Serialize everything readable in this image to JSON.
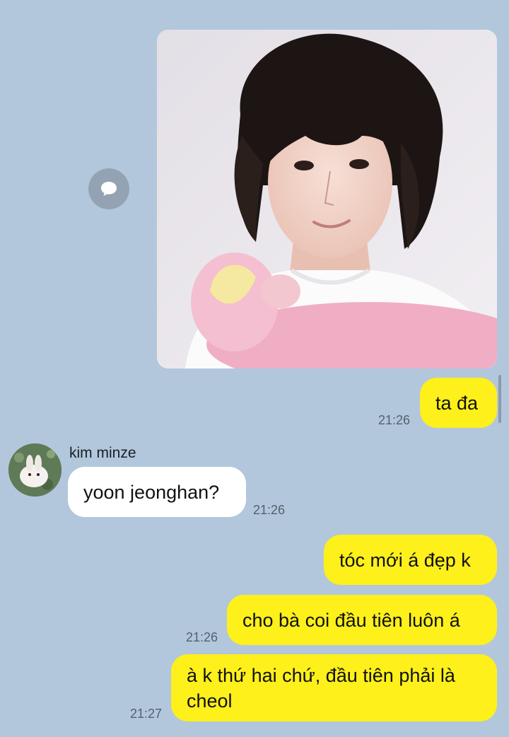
{
  "messages": [
    {
      "id": "m1",
      "type": "photo",
      "from": "me"
    },
    {
      "id": "m2",
      "text": "ta đa",
      "from": "me",
      "time": "21:26"
    },
    {
      "id": "m3",
      "sender": "kim minze",
      "text": "yoon jeonghan?",
      "from": "them",
      "time": "21:26"
    },
    {
      "id": "m4",
      "text": "tóc mới á đẹp k",
      "from": "me"
    },
    {
      "id": "m5",
      "text": "cho bà coi đầu tiên luôn á",
      "from": "me",
      "time": "21:26"
    },
    {
      "id": "m6",
      "text": "à k thứ hai chứ, đầu tiên phải là cheol",
      "from": "me",
      "time": "21:27"
    }
  ],
  "icons": {
    "share": "chat-bubble-icon",
    "avatar": "rabbit-avatar"
  },
  "colors": {
    "background": "#b2c7dc",
    "my_bubble": "#fef01b",
    "their_bubble": "#ffffff"
  }
}
